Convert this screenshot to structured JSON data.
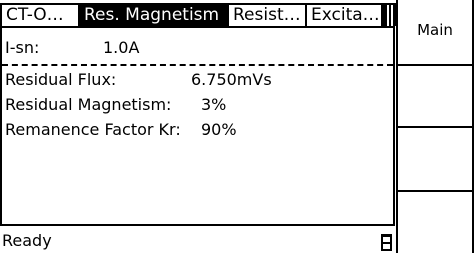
{
  "tabs": [
    {
      "label": "CT-O…",
      "active": false
    },
    {
      "label": "Res. Magnetism",
      "active": true
    },
    {
      "label": "Resist…",
      "active": false
    },
    {
      "label": "Excita…",
      "active": false
    }
  ],
  "panel": {
    "isn": {
      "label": "I-sn:",
      "value": "1.0A"
    },
    "rows": [
      {
        "label": "Residual Flux:",
        "value": "6.750mVs"
      },
      {
        "label": "Residual Magnetism:",
        "value": "3%"
      },
      {
        "label": "Remanence Factor Kr:",
        "value": "90%"
      }
    ]
  },
  "status": {
    "text": "Ready",
    "icon": "battery-icon"
  },
  "softkeys": [
    {
      "label": "Main"
    },
    {
      "label": ""
    },
    {
      "label": ""
    },
    {
      "label": ""
    }
  ],
  "colors": {
    "foreground": "#000000",
    "background": "#ffffff"
  }
}
